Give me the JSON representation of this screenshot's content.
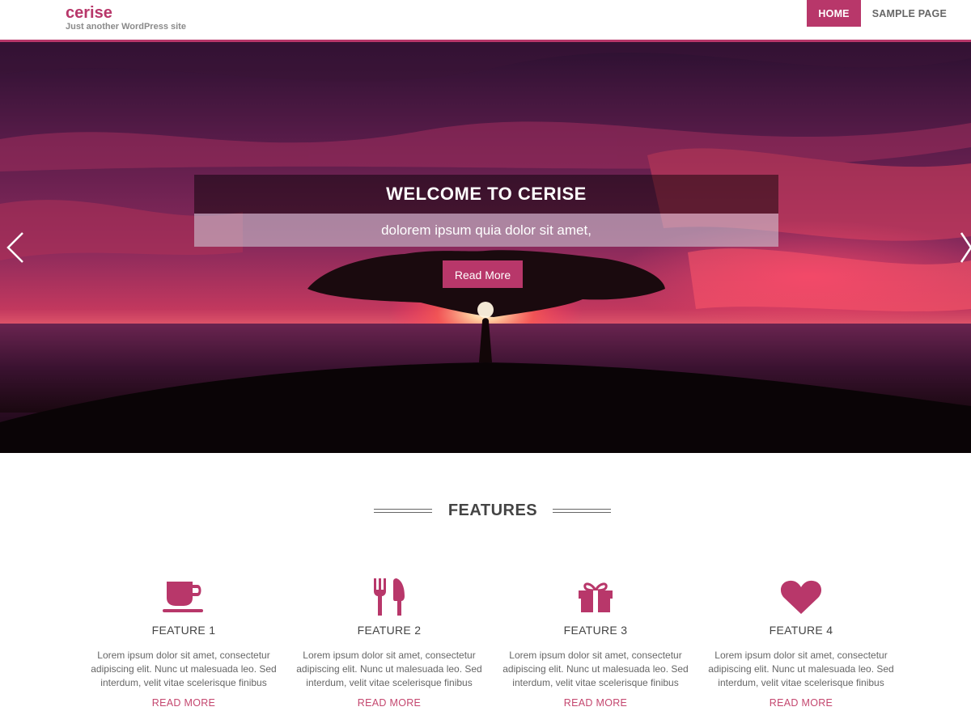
{
  "site": {
    "title": "cerise",
    "tagline": "Just another WordPress site"
  },
  "nav": {
    "items": [
      "HOME",
      "SAMPLE PAGE"
    ],
    "active": "HOME"
  },
  "slider": {
    "title": "WELCOME TO CERISE",
    "subtitle": "dolorem ipsum quia dolor sit amet,",
    "button_label": "Read More",
    "prev_icon": "chevron-left-icon",
    "next_icon": "chevron-right-icon"
  },
  "features": {
    "heading": "FEATURES",
    "items": [
      {
        "icon": "coffee-cup-icon",
        "title": "FEATURE 1",
        "text": "Lorem ipsum dolor sit amet, consectetur adipiscing elit. Nunc ut malesuada leo. Sed interdum, velit vitae scelerisque finibus",
        "link": "READ MORE"
      },
      {
        "icon": "cutlery-icon",
        "title": "FEATURE 2",
        "text": "Lorem ipsum dolor sit amet, consectetur adipiscing elit. Nunc ut malesuada leo. Sed interdum, velit vitae scelerisque finibus",
        "link": "READ MORE"
      },
      {
        "icon": "gift-icon",
        "title": "FEATURE 3",
        "text": "Lorem ipsum dolor sit amet, consectetur adipiscing elit. Nunc ut malesuada leo. Sed interdum, velit vitae scelerisque finibus",
        "link": "READ MORE"
      },
      {
        "icon": "heart-icon",
        "title": "FEATURE 4",
        "text": "Lorem ipsum dolor sit amet, consectetur adipiscing elit. Nunc ut malesuada leo. Sed interdum, velit vitae scelerisque finibus",
        "link": "READ MORE"
      }
    ]
  },
  "colors": {
    "accent": "#b8376a",
    "link": "#c4476f",
    "heading_text": "#444444"
  }
}
